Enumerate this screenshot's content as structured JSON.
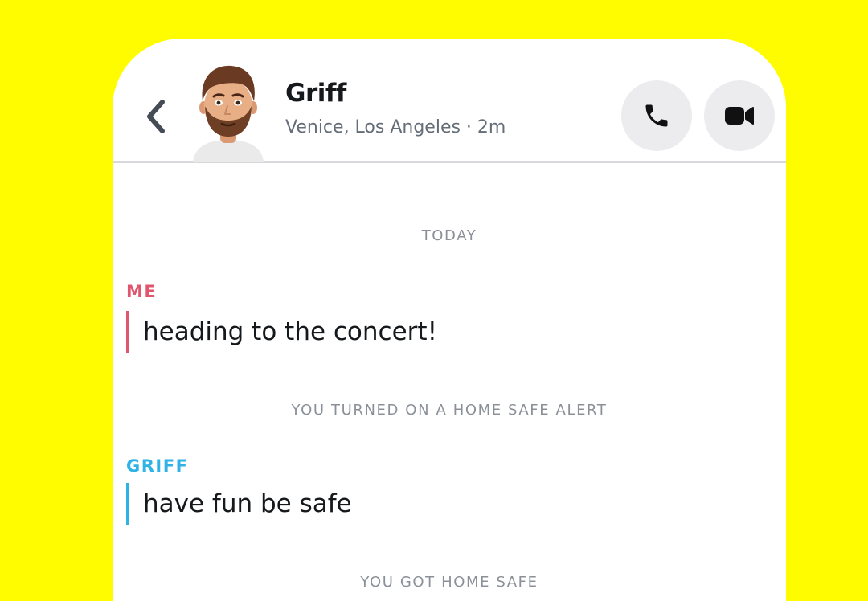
{
  "colors": {
    "background": "#FFFC00",
    "me_accent": "#E0566E",
    "friend_accent": "#2FB3E6",
    "system_text": "#8B9098"
  },
  "header": {
    "back_icon": "chevron-left-icon",
    "contact_name": "Griff",
    "location": "Venice, Los Angeles · 2m",
    "call_icon": "phone-icon",
    "video_icon": "video-camera-icon"
  },
  "chat": {
    "day_label": "TODAY",
    "messages": [
      {
        "sender": "ME",
        "text": "heading to the concert!"
      },
      {
        "sender": "GRIFF",
        "text": "have fun be safe"
      }
    ],
    "system_events": [
      "YOU TURNED ON A HOME SAFE ALERT",
      "YOU GOT HOME SAFE"
    ]
  }
}
